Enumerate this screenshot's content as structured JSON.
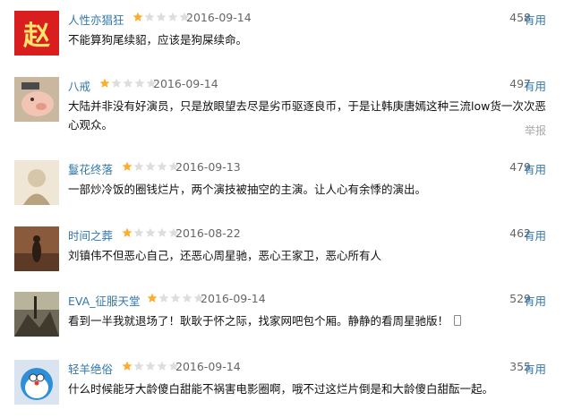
{
  "reviews": [
    {
      "user": "人性亦猖狂",
      "rating": 1,
      "date": "2016-09-14",
      "votes": "458",
      "useful": "有用",
      "content": "不能算狗尾续貂，应该是狗屎续命。",
      "avatar_text": "赵"
    },
    {
      "user": "八戒",
      "rating": 1,
      "date": "2016-09-14",
      "votes": "497",
      "useful": "有用",
      "content": "大陆并非没有好演员，只是放眼望去尽是劣币驱逐良币，于是让韩庚唐嫣这种三流low货一次次恶心观众。",
      "report": "举报"
    },
    {
      "user": "鬘花终落",
      "rating": 1,
      "date": "2016-09-13",
      "votes": "479",
      "useful": "有用",
      "content": "一部炒冷饭的圈钱烂片，两个演技被抽空的主演。让人心有余悸的演出。"
    },
    {
      "user": "时间之葬",
      "rating": 1,
      "date": "2016-08-22",
      "votes": "462",
      "useful": "有用",
      "content": "刘镇伟不但恶心自己，还恶心周星驰，恶心王家卫，恶心所有人"
    },
    {
      "user": "EVA_征服天堂",
      "rating": 1,
      "date": "2016-09-14",
      "votes": "529",
      "useful": "有用",
      "content": "看到一半我就退场了！耿耿于怀之际，找家网吧包个厢。静静的看周星驰版！"
    },
    {
      "user": "轻羊绝俗",
      "rating": 1,
      "date": "2016-09-14",
      "votes": "355",
      "useful": "有用",
      "content": "什么时候能牙大龄傻白甜能不祸害电影圈啊，哦不过这烂片倒是和大龄傻白甜酝一起。"
    }
  ],
  "colors": {
    "link": "#3377aa",
    "star_on": "#ffac2d",
    "star_off": "#dddddd"
  }
}
